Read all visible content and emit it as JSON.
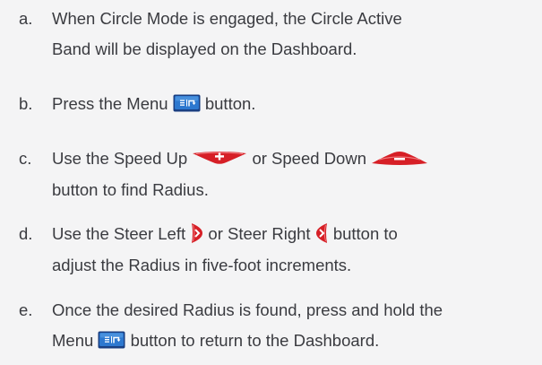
{
  "steps": [
    {
      "marker": "a.",
      "line1": "When Circle Mode is engaged, the Circle Active",
      "line2": "Band will be displayed on the Dashboard."
    },
    {
      "marker": "b.",
      "before": "Press the Menu",
      "after": "button."
    },
    {
      "marker": "c.",
      "before": "Use the Speed Up",
      "middle": "or Speed Down",
      "line2": "button to find Radius."
    },
    {
      "marker": "d.",
      "before": "Use the Steer Left",
      "middle": "or Steer Right",
      "after": "button to",
      "line2": "adjust the Radius in five-foot increments."
    },
    {
      "marker": "e.",
      "line1": "Once the desired Radius is found, press and hold the",
      "before2": "Menu",
      "after2": "button to return to the Dashboard."
    }
  ],
  "icons": {
    "menu": "menu-button-icon",
    "speed_up": "speed-up-button-icon",
    "speed_down": "speed-down-button-icon",
    "steer_left": "steer-left-button-icon",
    "steer_right": "steer-right-button-icon"
  },
  "colors": {
    "background": "#f4f4f5",
    "text": "#3a3b40",
    "button_red": "#d61f26",
    "menu_blue": "#1d64b8"
  }
}
